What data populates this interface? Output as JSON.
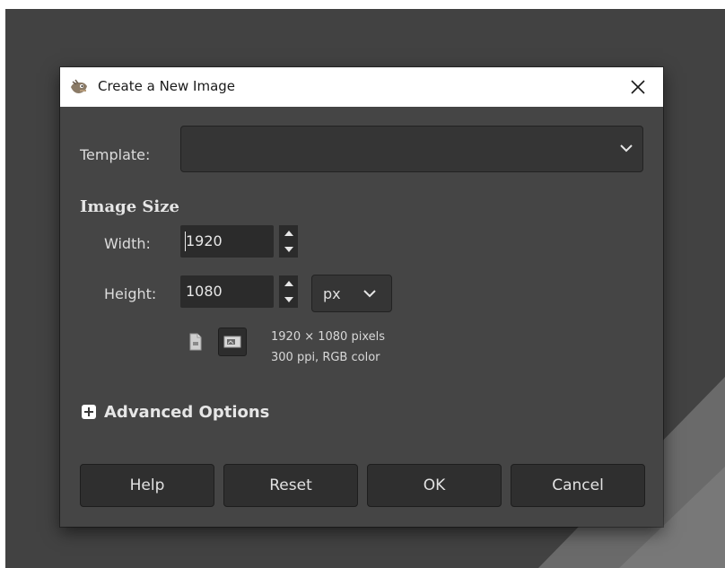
{
  "window": {
    "title": "Create a New Image",
    "close_icon": "close-icon",
    "app_icon": "gimp-wilber-icon"
  },
  "template": {
    "label": "Template:",
    "value": ""
  },
  "image_size": {
    "title": "Image Size",
    "width_label": "Width:",
    "width_value": "1920",
    "height_label": "Height:",
    "height_value": "1080",
    "unit": "px",
    "info_line1": "1920 × 1080 pixels",
    "info_line2": "300 ppi, RGB color"
  },
  "advanced": {
    "label": "Advanced Options"
  },
  "buttons": {
    "help": "Help",
    "reset": "Reset",
    "ok": "OK",
    "cancel": "Cancel"
  },
  "colors": {
    "desktop_bg": "#424242",
    "dialog_bg": "#454545",
    "titlebar_bg": "#ffffff",
    "button_bg": "#2f2f2f"
  }
}
